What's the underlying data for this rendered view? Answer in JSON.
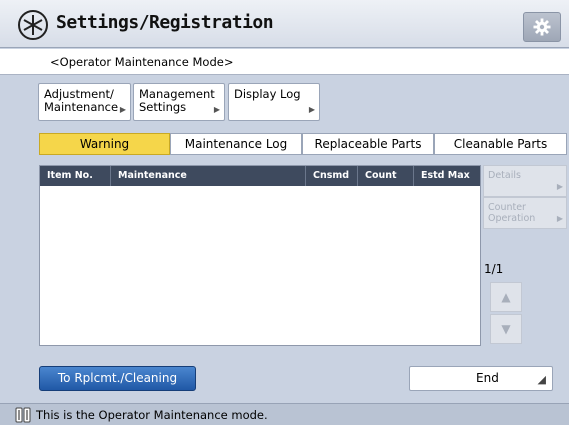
{
  "header": {
    "title": "Settings/Registration",
    "icon": "settings-star-icon",
    "gear_icon": "gear-icon"
  },
  "mode_label": "<Operator Maintenance Mode>",
  "menu": [
    {
      "line1": "Adjustment/",
      "line2": "Maintenance"
    },
    {
      "line1": "Management",
      "line2": "Settings"
    },
    {
      "line1": "Display Log",
      "line2": ""
    }
  ],
  "tabs": [
    {
      "label": "Warning",
      "active": true
    },
    {
      "label": "Maintenance Log",
      "active": false
    },
    {
      "label": "Replaceable Parts",
      "active": false
    },
    {
      "label": "Cleanable Parts",
      "active": false
    }
  ],
  "table": {
    "columns": [
      "Item No.",
      "Maintenance",
      "Cnsmd",
      "Count",
      "Estd Max"
    ],
    "rows": []
  },
  "side_buttons": {
    "details": "Details",
    "counter_line1": "Counter",
    "counter_line2": "Operation"
  },
  "pagination": {
    "page": "1/1"
  },
  "buttons": {
    "replace_cleaning": "To Rplcmt./Cleaning",
    "end": "End"
  },
  "status": {
    "text": "This is the Operator Maintenance mode."
  },
  "colors": {
    "active_tab": "#f5d64a",
    "primary_button": "#2f6fc0",
    "table_header": "#3e4a5e"
  }
}
